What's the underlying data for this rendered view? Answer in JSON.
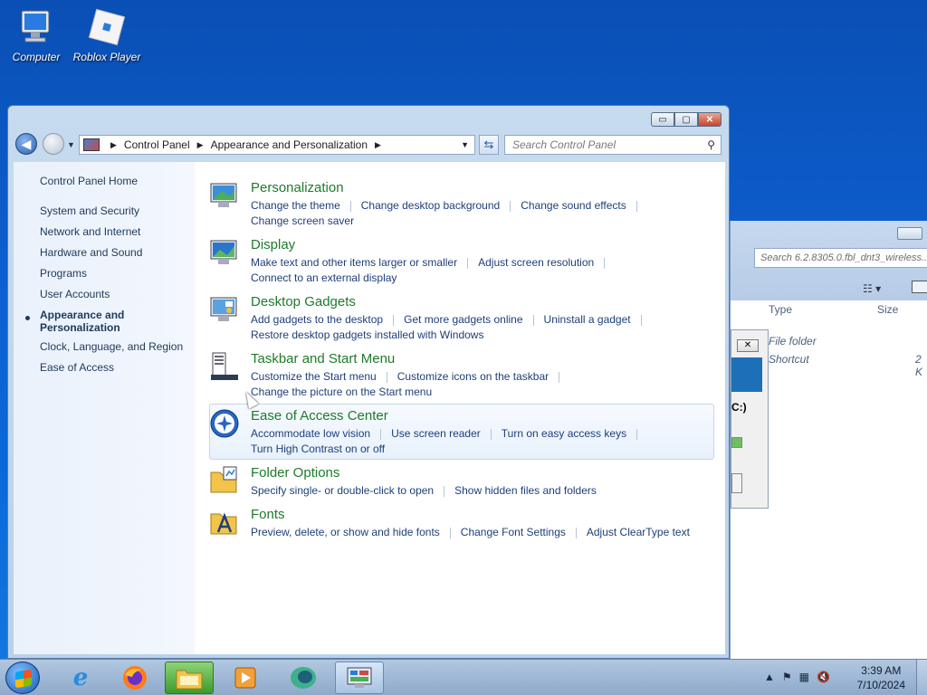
{
  "desktop": {
    "icons": [
      {
        "label": "Computer",
        "icon": "computer-icon"
      },
      {
        "label": "Roblox Player",
        "icon": "roblox-icon"
      }
    ]
  },
  "background_window": {
    "search_placeholder": "Search 6.2.8305.0.fbl_dnt3_wireless...",
    "columns": [
      "Type",
      "Size"
    ],
    "rows": [
      {
        "type": "File folder",
        "size": ""
      },
      {
        "type": "Shortcut",
        "size": "2 K"
      }
    ],
    "dialog_fragment": "C:)"
  },
  "window": {
    "breadcrumb": [
      "Control Panel",
      "Appearance and Personalization"
    ],
    "search_placeholder": "Search Control Panel",
    "caption": {
      "minimize": "▭",
      "maximize": "▢",
      "close": "✕"
    }
  },
  "left_pane": {
    "home": "Control Panel Home",
    "items": [
      "System and Security",
      "Network and Internet",
      "Hardware and Sound",
      "Programs",
      "User Accounts"
    ],
    "active_line1": "Appearance and",
    "active_line2": "Personalization",
    "after": [
      "Clock, Language, and Region",
      "Ease of Access"
    ]
  },
  "categories": [
    {
      "title": "Personalization",
      "icon": "personalization-icon",
      "row1": [
        "Change the theme",
        "Change desktop background",
        "Change sound effects"
      ],
      "row2": [
        "Change screen saver"
      ]
    },
    {
      "title": "Display",
      "icon": "display-icon",
      "row1": [
        "Make text and other items larger or smaller",
        "Adjust screen resolution"
      ],
      "row2": [
        "Connect to an external display"
      ]
    },
    {
      "title": "Desktop Gadgets",
      "icon": "gadgets-icon",
      "row1": [
        "Add gadgets to the desktop",
        "Get more gadgets online",
        "Uninstall a gadget"
      ],
      "row2": [
        "Restore desktop gadgets installed with Windows"
      ]
    },
    {
      "title": "Taskbar and Start Menu",
      "icon": "taskbar-icon",
      "row1": [
        "Customize the Start menu",
        "Customize icons on the taskbar"
      ],
      "row2": [
        "Change the picture on the Start menu"
      ]
    },
    {
      "title": "Ease of Access Center",
      "icon": "ease-of-access-icon",
      "row1": [
        "Accommodate low vision",
        "Use screen reader",
        "Turn on easy access keys"
      ],
      "row2": [
        "Turn High Contrast on or off"
      ]
    },
    {
      "title": "Folder Options",
      "icon": "folder-options-icon",
      "row1": [
        "Specify single- or double-click to open",
        "Show hidden files and folders"
      ],
      "row2": []
    },
    {
      "title": "Fonts",
      "icon": "fonts-icon",
      "row1": [
        "Preview, delete, or show and hide fonts",
        "Change Font Settings",
        "Adjust ClearType text"
      ],
      "row2": []
    }
  ],
  "taskbar": {
    "apps": [
      "internet-explorer-icon",
      "firefox-icon",
      "file-explorer-icon",
      "media-player-icon",
      "app-icon",
      "control-panel-icon"
    ],
    "time": "3:39 AM",
    "date": "7/10/2024"
  }
}
